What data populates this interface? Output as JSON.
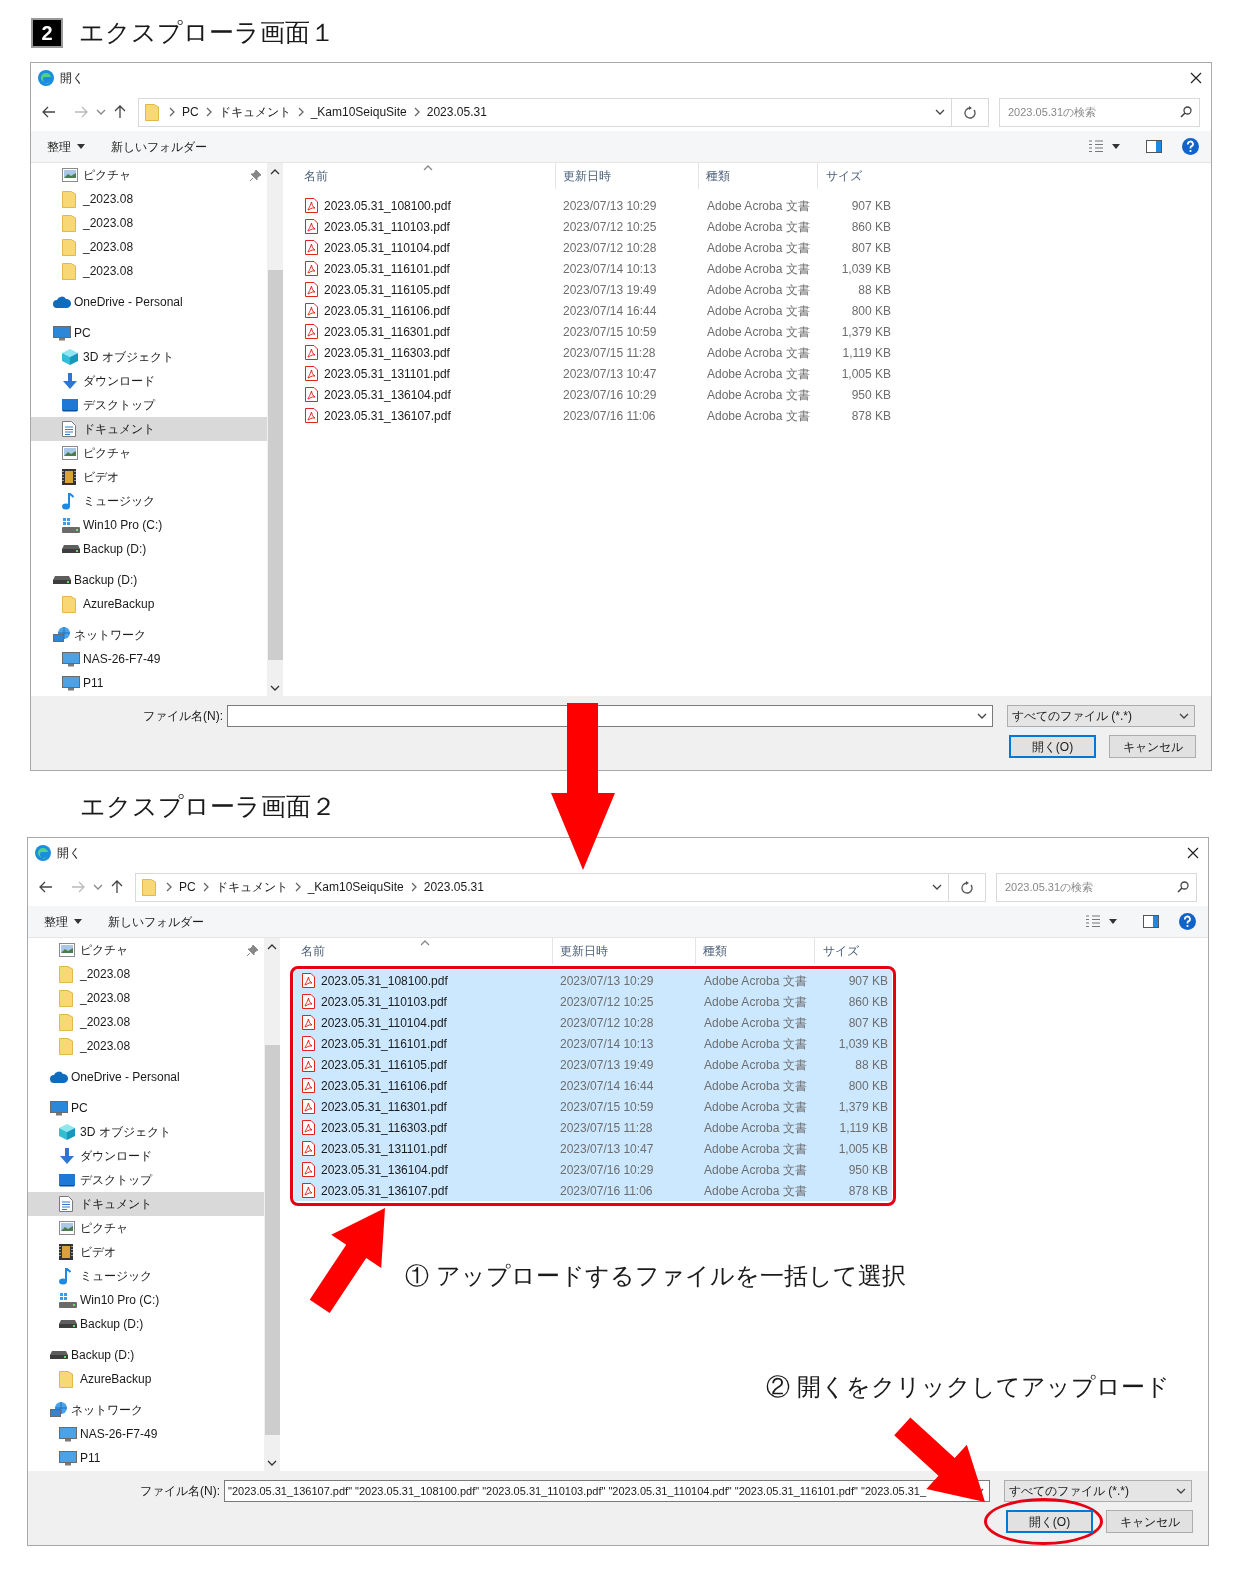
{
  "sections": [
    {
      "badge": "2",
      "heading": "エクスプローラ画面１",
      "dialog": {
        "title": "開く",
        "breadcrumb": [
          "PC",
          "ドキュメント",
          "_Kam10SeiquSite",
          "2023.05.31"
        ],
        "search": {
          "placeholder": "2023.05.31の検索"
        },
        "toolbar": [
          "整理",
          "新しいフォルダー"
        ],
        "sidebar": [
          {
            "children": [
              {
                "kind": "pictures",
                "label": "ピクチャ",
                "pinned": true,
                "selected": false
              },
              {
                "kind": "folder",
                "label": "_2023.08",
                "pinned": false,
                "selected": false
              },
              {
                "kind": "folder",
                "label": "_2023.08",
                "pinned": false,
                "selected": false
              },
              {
                "kind": "folder",
                "label": "_2023.08",
                "pinned": false,
                "selected": false
              },
              {
                "kind": "folder",
                "label": "_2023.08",
                "pinned": false,
                "selected": false
              }
            ]
          },
          {
            "kind": "cloud",
            "label": "OneDrive - Personal",
            "selected": false
          },
          {
            "kind": "pc",
            "label": "PC",
            "selected": false,
            "children": [
              {
                "kind": "cube",
                "label": "3D オブジェクト",
                "selected": false
              },
              {
                "kind": "download",
                "label": "ダウンロード",
                "selected": false
              },
              {
                "kind": "desktop",
                "label": "デスクトップ",
                "selected": false
              },
              {
                "kind": "documents",
                "label": "ドキュメント",
                "selected": true
              },
              {
                "kind": "pictures",
                "label": "ピクチャ",
                "selected": false
              },
              {
                "kind": "video",
                "label": "ビデオ",
                "selected": false
              },
              {
                "kind": "music",
                "label": "ミュージック",
                "selected": false
              },
              {
                "kind": "system-drive",
                "label": "Win10 Pro (C:)",
                "selected": false
              },
              {
                "kind": "drive",
                "label": "Backup (D:)",
                "selected": false
              }
            ]
          },
          {
            "kind": "drive",
            "label": "Backup (D:)",
            "selected": false,
            "children": [
              {
                "kind": "folder",
                "label": "AzureBackup",
                "selected": false
              }
            ]
          },
          {
            "kind": "network",
            "label": "ネットワーク",
            "selected": false,
            "children": [
              {
                "kind": "monitor",
                "label": "NAS-26-F7-49",
                "selected": false
              },
              {
                "kind": "monitor",
                "label": "P11",
                "selected": false
              }
            ]
          }
        ],
        "columns": [
          "名前",
          "更新日時",
          "種類",
          "サイズ"
        ],
        "files_highlighted": false,
        "files": [
          {
            "name": "2023.05.31_108100.pdf",
            "modified": "2023/07/13 10:29",
            "type": "Adobe Acroba 文書",
            "size": "907 KB",
            "selected": false
          },
          {
            "name": "2023.05.31_110103.pdf",
            "modified": "2023/07/12 10:25",
            "type": "Adobe Acroba 文書",
            "size": "860 KB",
            "selected": false
          },
          {
            "name": "2023.05.31_110104.pdf",
            "modified": "2023/07/12 10:28",
            "type": "Adobe Acroba 文書",
            "size": "807 KB",
            "selected": false
          },
          {
            "name": "2023.05.31_116101.pdf",
            "modified": "2023/07/14 10:13",
            "type": "Adobe Acroba 文書",
            "size": "1,039 KB",
            "selected": false
          },
          {
            "name": "2023.05.31_116105.pdf",
            "modified": "2023/07/13 19:49",
            "type": "Adobe Acroba 文書",
            "size": "88 KB",
            "selected": false
          },
          {
            "name": "2023.05.31_116106.pdf",
            "modified": "2023/07/14 16:44",
            "type": "Adobe Acroba 文書",
            "size": "800 KB",
            "selected": false
          },
          {
            "name": "2023.05.31_116301.pdf",
            "modified": "2023/07/15 10:59",
            "type": "Adobe Acroba 文書",
            "size": "1,379 KB",
            "selected": false
          },
          {
            "name": "2023.05.31_116303.pdf",
            "modified": "2023/07/15 11:28",
            "type": "Adobe Acroba 文書",
            "size": "1,119 KB",
            "selected": false
          },
          {
            "name": "2023.05.31_131101.pdf",
            "modified": "2023/07/13 10:47",
            "type": "Adobe Acroba 文書",
            "size": "1,005 KB",
            "selected": false
          },
          {
            "name": "2023.05.31_136104.pdf",
            "modified": "2023/07/16 10:29",
            "type": "Adobe Acroba 文書",
            "size": "950 KB",
            "selected": false
          },
          {
            "name": "2023.05.31_136107.pdf",
            "modified": "2023/07/16 11:06",
            "type": "Adobe Acroba 文書",
            "size": "878 KB",
            "selected": false
          }
        ],
        "filename": {
          "label": "ファイル名(N):"
        },
        "filter": "すべてのファイル (*.*)",
        "open_button": {
          "label": "開く(O)",
          "circled": false
        },
        "cancel_button": "キャンセル"
      }
    },
    {
      "heading": "エクスプローラ画面２",
      "dialog": {
        "title": "開く",
        "breadcrumb": [
          "PC",
          "ドキュメント",
          "_Kam10SeiquSite",
          "2023.05.31"
        ],
        "search": {
          "placeholder": "2023.05.31の検索"
        },
        "toolbar": [
          "整理",
          "新しいフォルダー"
        ],
        "sidebar": [
          {
            "children": [
              {
                "kind": "pictures",
                "label": "ピクチャ",
                "pinned": true,
                "selected": false
              },
              {
                "kind": "folder",
                "label": "_2023.08",
                "pinned": false,
                "selected": false
              },
              {
                "kind": "folder",
                "label": "_2023.08",
                "pinned": false,
                "selected": false
              },
              {
                "kind": "folder",
                "label": "_2023.08",
                "pinned": false,
                "selected": false
              },
              {
                "kind": "folder",
                "label": "_2023.08",
                "pinned": false,
                "selected": false
              }
            ]
          },
          {
            "kind": "cloud",
            "label": "OneDrive - Personal",
            "selected": false
          },
          {
            "kind": "pc",
            "label": "PC",
            "selected": false,
            "children": [
              {
                "kind": "cube",
                "label": "3D オブジェクト",
                "selected": false
              },
              {
                "kind": "download",
                "label": "ダウンロード",
                "selected": false
              },
              {
                "kind": "desktop",
                "label": "デスクトップ",
                "selected": false
              },
              {
                "kind": "documents",
                "label": "ドキュメント",
                "selected": true
              },
              {
                "kind": "pictures",
                "label": "ピクチャ",
                "selected": false
              },
              {
                "kind": "video",
                "label": "ビデオ",
                "selected": false
              },
              {
                "kind": "music",
                "label": "ミュージック",
                "selected": false
              },
              {
                "kind": "system-drive",
                "label": "Win10 Pro (C:)",
                "selected": false
              },
              {
                "kind": "drive",
                "label": "Backup (D:)",
                "selected": false
              }
            ]
          },
          {
            "kind": "drive",
            "label": "Backup (D:)",
            "selected": false,
            "children": [
              {
                "kind": "folder",
                "label": "AzureBackup",
                "selected": false
              }
            ]
          },
          {
            "kind": "network",
            "label": "ネットワーク",
            "selected": false,
            "children": [
              {
                "kind": "monitor",
                "label": "NAS-26-F7-49",
                "selected": false
              },
              {
                "kind": "monitor",
                "label": "P11",
                "selected": false
              }
            ]
          }
        ],
        "columns": [
          "名前",
          "更新日時",
          "種類",
          "サイズ"
        ],
        "files_highlighted": true,
        "files": [
          {
            "name": "2023.05.31_108100.pdf",
            "modified": "2023/07/13 10:29",
            "type": "Adobe Acroba 文書",
            "size": "907 KB",
            "selected": true
          },
          {
            "name": "2023.05.31_110103.pdf",
            "modified": "2023/07/12 10:25",
            "type": "Adobe Acroba 文書",
            "size": "860 KB",
            "selected": true
          },
          {
            "name": "2023.05.31_110104.pdf",
            "modified": "2023/07/12 10:28",
            "type": "Adobe Acroba 文書",
            "size": "807 KB",
            "selected": true
          },
          {
            "name": "2023.05.31_116101.pdf",
            "modified": "2023/07/14 10:13",
            "type": "Adobe Acroba 文書",
            "size": "1,039 KB",
            "selected": true
          },
          {
            "name": "2023.05.31_116105.pdf",
            "modified": "2023/07/13 19:49",
            "type": "Adobe Acroba 文書",
            "size": "88 KB",
            "selected": true
          },
          {
            "name": "2023.05.31_116106.pdf",
            "modified": "2023/07/14 16:44",
            "type": "Adobe Acroba 文書",
            "size": "800 KB",
            "selected": true
          },
          {
            "name": "2023.05.31_116301.pdf",
            "modified": "2023/07/15 10:59",
            "type": "Adobe Acroba 文書",
            "size": "1,379 KB",
            "selected": true
          },
          {
            "name": "2023.05.31_116303.pdf",
            "modified": "2023/07/15 11:28",
            "type": "Adobe Acroba 文書",
            "size": "1,119 KB",
            "selected": true
          },
          {
            "name": "2023.05.31_131101.pdf",
            "modified": "2023/07/13 10:47",
            "type": "Adobe Acroba 文書",
            "size": "1,005 KB",
            "selected": true
          },
          {
            "name": "2023.05.31_136104.pdf",
            "modified": "2023/07/16 10:29",
            "type": "Adobe Acroba 文書",
            "size": "950 KB",
            "selected": true
          },
          {
            "name": "2023.05.31_136107.pdf",
            "modified": "2023/07/16 11:06",
            "type": "Adobe Acroba 文書",
            "size": "878 KB",
            "selected": true
          }
        ],
        "filename": {
          "label": "ファイル名(N):",
          "value": "\"2023.05.31_136107.pdf\" \"2023.05.31_108100.pdf\" \"2023.05.31_110103.pdf\" \"2023.05.31_110104.pdf\" \"2023.05.31_116101.pdf\" \"2023.05.31_"
        },
        "filter": "すべてのファイル (*.*)",
        "open_button": {
          "label": "開く(O)",
          "circled": true
        },
        "cancel_button": "キャンセル"
      }
    }
  ],
  "annotations": [
    {
      "text": "① アップロードするファイルを一括して選択"
    },
    {
      "text": "② 開くをクリックしてアップロード"
    }
  ]
}
